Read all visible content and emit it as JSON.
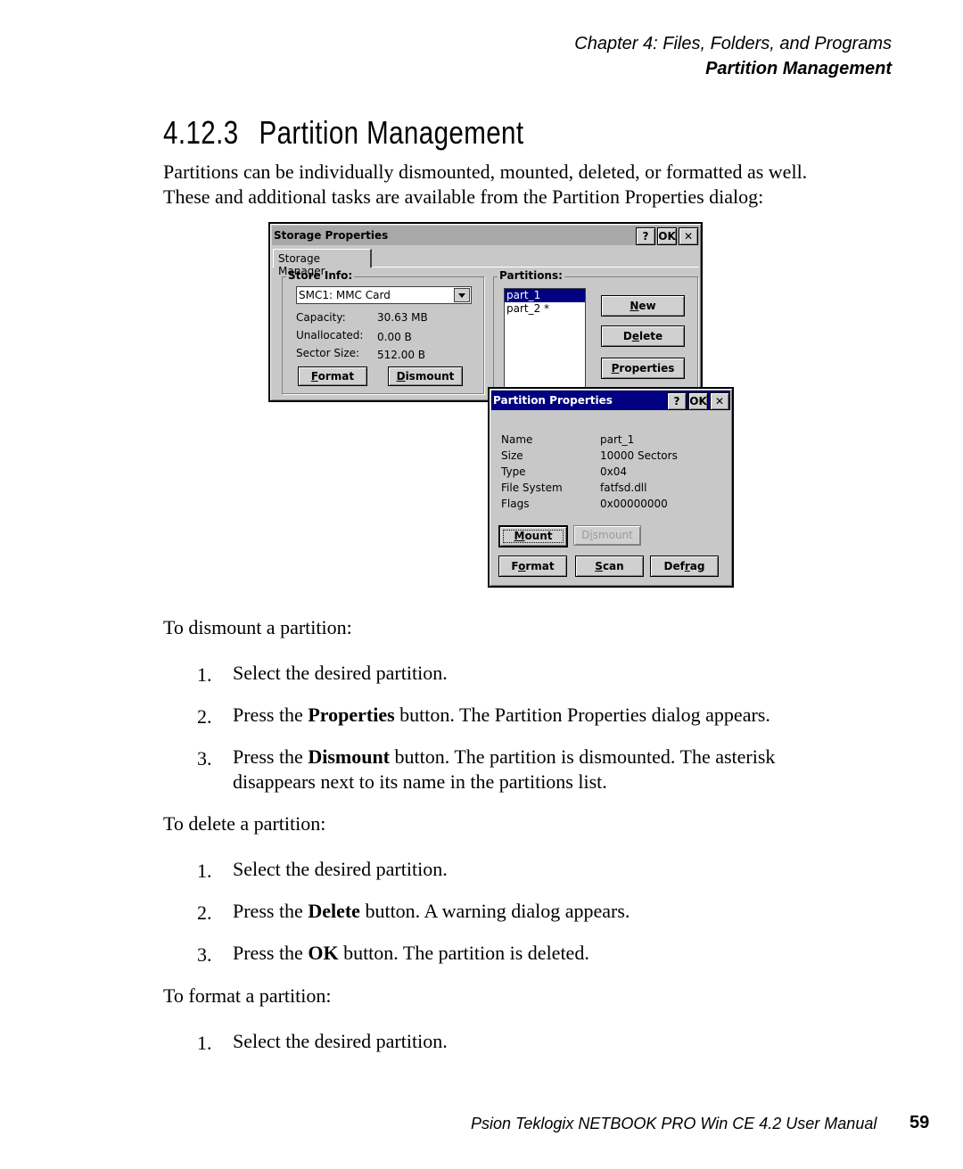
{
  "header": {
    "chapter": "Chapter 4:  Files, Folders, and Programs",
    "section": "Partition Management"
  },
  "heading": {
    "number": "4.12.3",
    "title": "Partition Management"
  },
  "intro": {
    "line1": "Partitions can be individually dismounted, mounted, deleted, or formatted as well.",
    "line2": "These and additional tasks are available from the Partition Properties dialog:"
  },
  "storage_dialog": {
    "title": "Storage Properties",
    "help_label": "?",
    "ok_label": "OK",
    "close_label": "✕",
    "tab_label": "Storage Manager",
    "store_info": {
      "label": "Store Info:",
      "selected_store": "SMC1: MMC Card",
      "capacity_label": "Capacity:",
      "capacity_value": "30.63 MB",
      "unallocated_label": "Unallocated:",
      "unallocated_value": "0.00 B",
      "sector_label": "Sector Size:",
      "sector_value": "512.00 B",
      "format_pre": "",
      "format_u": "F",
      "format_post": "ormat",
      "dismount_pre": "",
      "dismount_u": "D",
      "dismount_post": "ismount"
    },
    "partitions": {
      "label": "Partitions:",
      "items": [
        "part_1",
        "part_2 *"
      ],
      "new_pre": "",
      "new_u": "N",
      "new_post": "ew",
      "delete_pre": "D",
      "delete_u": "e",
      "delete_post": "lete",
      "properties_pre": "",
      "properties_u": "P",
      "properties_post": "roperties"
    },
    "colors": {
      "selection": "#000080",
      "face": "#c8c8c8",
      "title_inactive": "#a8a8a8"
    }
  },
  "partition_dialog": {
    "title": "Partition Properties",
    "help_label": "?",
    "ok_label": "OK",
    "close_label": "✕",
    "fields": [
      {
        "label": "Name",
        "value": "part_1"
      },
      {
        "label": "Size",
        "value": "10000 Sectors"
      },
      {
        "label": "Type",
        "value": "0x04"
      },
      {
        "label": "File System",
        "value": "fatfsd.dll"
      },
      {
        "label": "Flags",
        "value": "0x00000000"
      }
    ],
    "mount_pre": "",
    "mount_u": "M",
    "mount_post": "ount",
    "dismount_pre": "D",
    "dismount_u": "i",
    "dismount_post": "smount",
    "format_pre": "F",
    "format_u": "o",
    "format_post": "rmat",
    "scan_pre": "",
    "scan_u": "S",
    "scan_post": "can",
    "defrag_pre": "Def",
    "defrag_u": "r",
    "defrag_post": "ag",
    "colors": {
      "title_active": "#000080"
    }
  },
  "dismount_section": {
    "intro": "To dismount a partition:",
    "steps": [
      {
        "num": "1.",
        "pre": "Select the desired partition.",
        "bold": "",
        "post": ""
      },
      {
        "num": "2.",
        "pre": "Press the ",
        "bold": "Properties",
        "post": " button. The Partition Properties dialog appears."
      },
      {
        "num": "3.",
        "pre": "Press the ",
        "bold": "Dismount",
        "post": " button. The partition is dismounted. The asterisk",
        "line2": "disappears next to its name in the partitions list."
      }
    ]
  },
  "delete_section": {
    "intro": "To delete a partition:",
    "steps": [
      {
        "num": "1.",
        "pre": "Select the desired partition.",
        "bold": "",
        "post": ""
      },
      {
        "num": "2.",
        "pre": "Press the ",
        "bold": "Delete",
        "post": " button. A warning dialog appears."
      },
      {
        "num": "3.",
        "pre": "Press the ",
        "bold": "OK",
        "post": " button. The partition is deleted."
      }
    ]
  },
  "format_section": {
    "intro": "To format a partition:",
    "steps": [
      {
        "num": "1.",
        "pre": "Select the desired partition.",
        "bold": "",
        "post": ""
      }
    ]
  },
  "footer": {
    "manual": "Psion Teklogix NETBOOK PRO Win CE 4.2 User Manual",
    "page": "59"
  }
}
